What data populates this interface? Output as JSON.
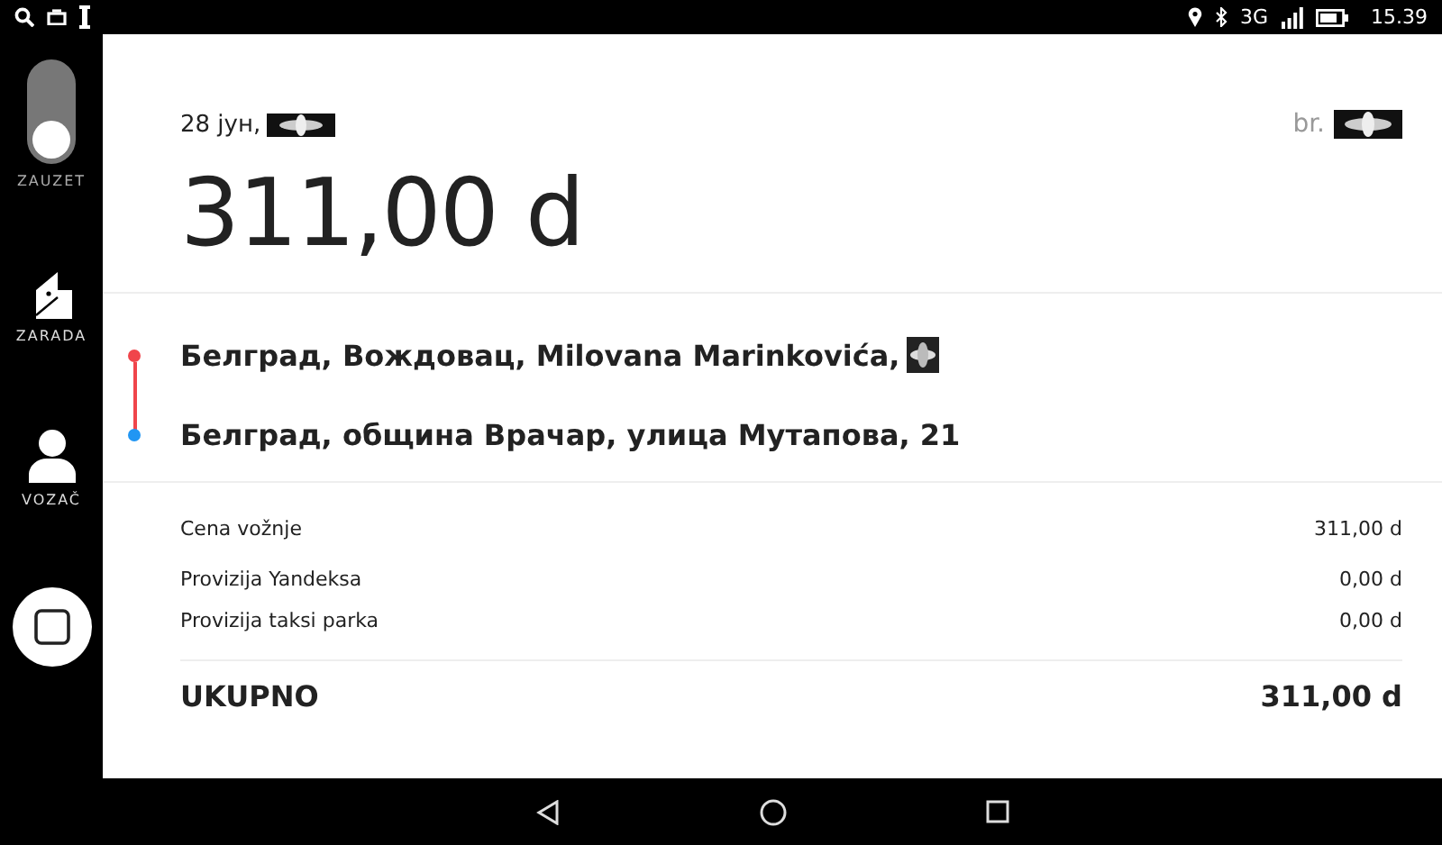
{
  "status_bar": {
    "time": "15.39",
    "network": "3G"
  },
  "sidebar": {
    "items": [
      {
        "kind": "toggle",
        "label": "ZAUZET",
        "on": false
      },
      {
        "kind": "wallet",
        "label": "ZARADA"
      },
      {
        "kind": "person",
        "label": "VOZAČ"
      },
      {
        "kind": "square"
      }
    ]
  },
  "order": {
    "date": "28 јун,",
    "number_label": "br.",
    "amount": "311,00 d",
    "route": [
      {
        "address": "Белград, Вождовац, Milovana Marinkovića,",
        "color": "#f0454b"
      },
      {
        "address": "Белград, община Врачар, улица Мутапова, 21",
        "color": "#2196f3"
      }
    ],
    "fees": [
      {
        "label": "Cena vožnje",
        "value": "311,00 d"
      },
      {
        "label": "Provizija Yandeksa",
        "value": "0,00 d"
      },
      {
        "label": "Provizija taksi parka",
        "value": "0,00 d"
      }
    ],
    "total": {
      "label": "UKUPNO",
      "value": "311,00 d"
    }
  }
}
